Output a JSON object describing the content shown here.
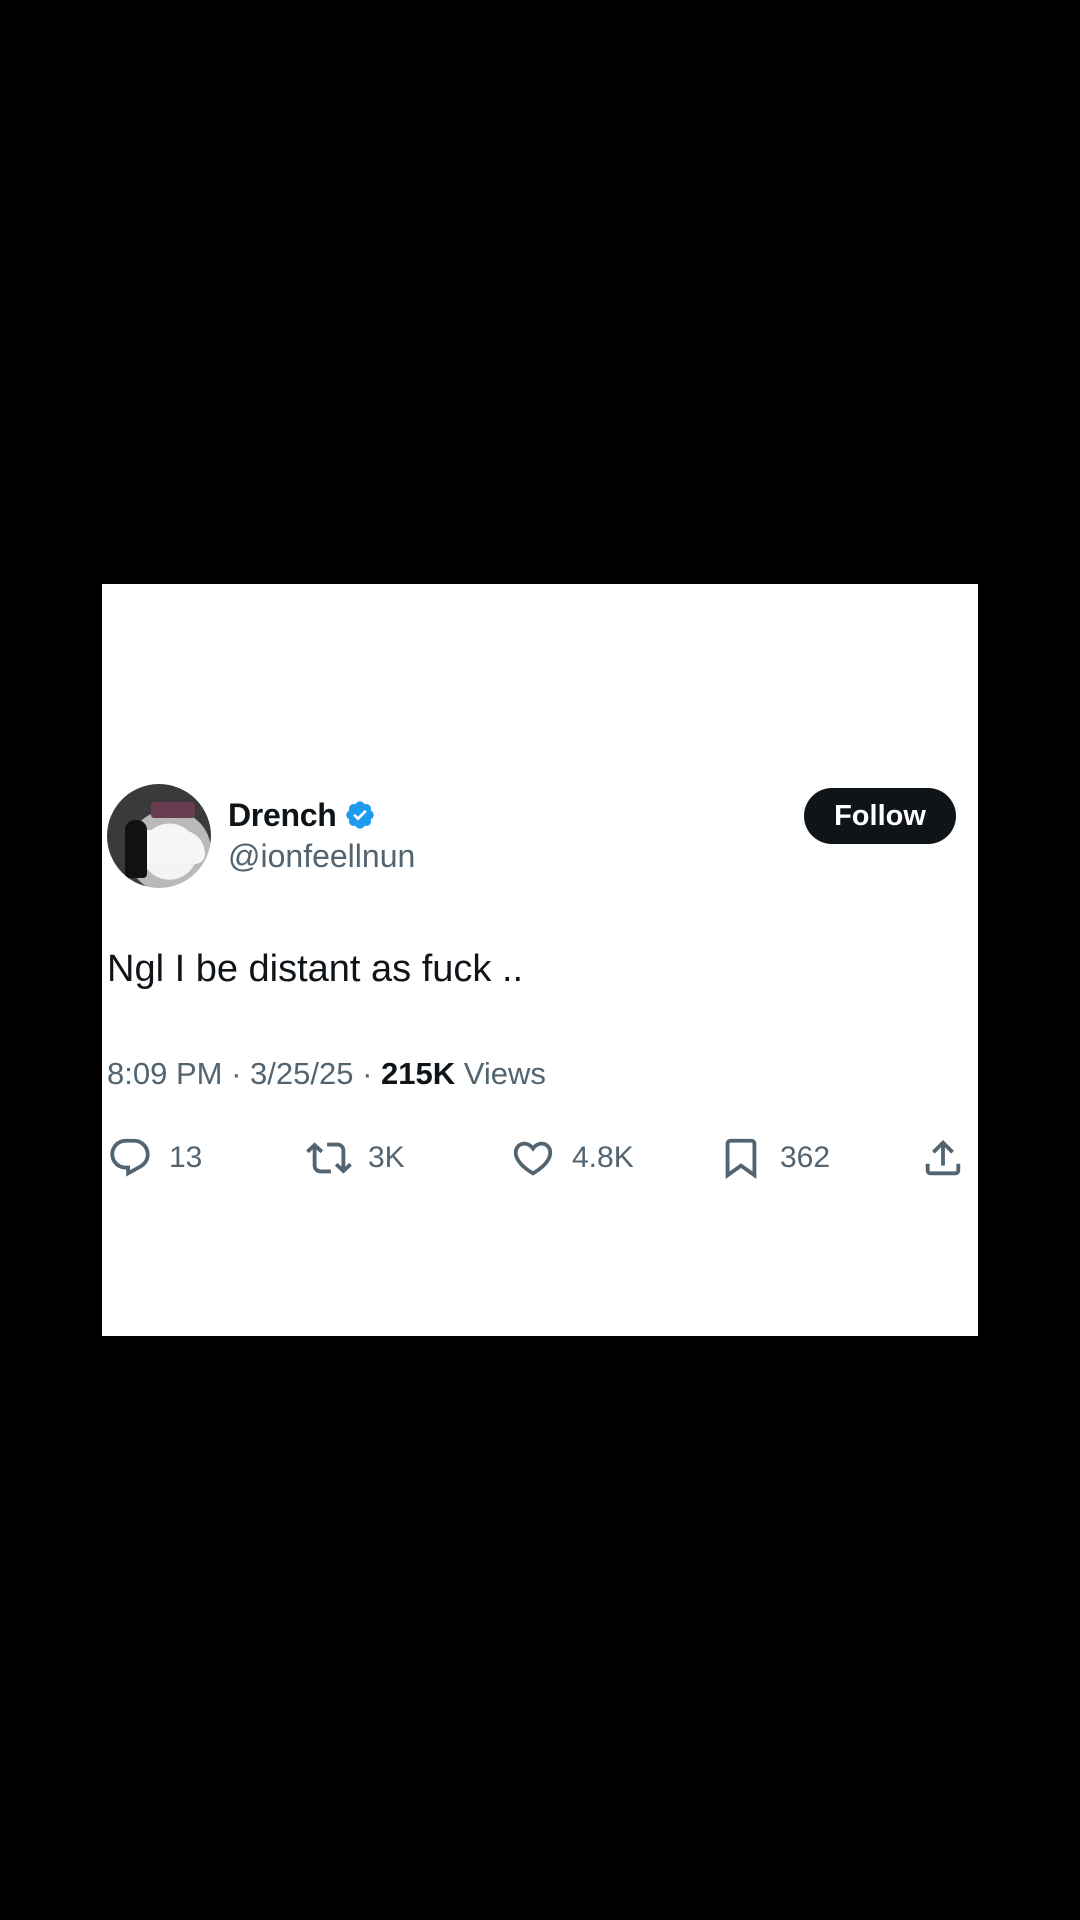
{
  "tweet": {
    "display_name": "Drench",
    "handle": "@ionfeellnun",
    "follow_label": "Follow",
    "text": "Ngl I be distant as fuck ..",
    "time": "8:09 PM",
    "date": "3/25/25",
    "views_count": "215K",
    "views_label": "Views",
    "separator": "·"
  },
  "actions": {
    "replies": "13",
    "reposts": "3K",
    "likes": "4.8K",
    "bookmarks": "362"
  },
  "icons": {
    "verified": "verified-badge-icon",
    "reply": "reply-icon",
    "repost": "repost-icon",
    "like": "heart-icon",
    "bookmark": "bookmark-icon",
    "share": "share-icon"
  },
  "colors": {
    "background": "#000000",
    "card": "#ffffff",
    "text_primary": "#0f1419",
    "text_secondary": "#536471",
    "verified_blue": "#1d9bf0",
    "button": "#0f1419"
  }
}
